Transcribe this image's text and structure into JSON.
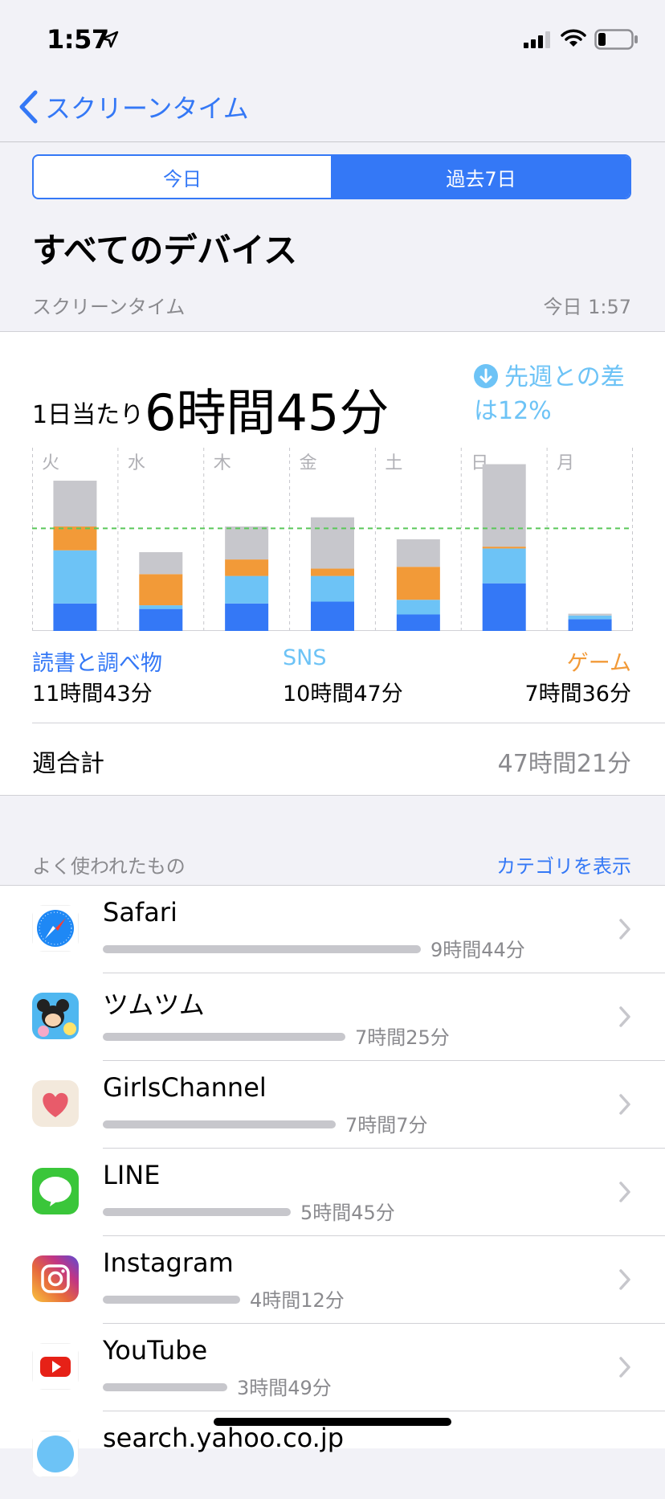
{
  "status": {
    "time": "1:57"
  },
  "nav": {
    "back_label": "スクリーンタイム"
  },
  "segment": {
    "today": "今日",
    "week": "過去7日"
  },
  "device_title": "すべてのデバイス",
  "section": {
    "label": "スクリーンタイム",
    "updated": "今日 1:57"
  },
  "summary": {
    "avg_label": "1日当たり",
    "avg_value": "6時間45分",
    "diff_text": "先週との差は12%"
  },
  "chart_data": {
    "type": "bar",
    "stacked": true,
    "categories": [
      "火",
      "水",
      "木",
      "金",
      "土",
      "日",
      "月"
    ],
    "series": [
      {
        "name": "読書と調べ物",
        "color": "#3478f6",
        "values": [
          0.75,
          0.6,
          0.75,
          0.8,
          0.45,
          1.3,
          0.32
        ]
      },
      {
        "name": "SNS",
        "color": "#6dc3f6",
        "values": [
          1.45,
          0.1,
          0.75,
          0.7,
          0.4,
          0.95,
          0.1
        ]
      },
      {
        "name": "ゲーム",
        "color": "#f29a38",
        "values": [
          0.65,
          0.85,
          0.45,
          0.2,
          0.9,
          0.05,
          0.0
        ]
      },
      {
        "name": "その他",
        "color": "#c7c7cc",
        "values": [
          1.25,
          0.6,
          0.9,
          1.4,
          0.75,
          2.25,
          0.05
        ]
      }
    ],
    "average": 2.8,
    "ylim": [
      0,
      5
    ],
    "grid": true
  },
  "categories": [
    {
      "name": "読書と調べ物",
      "value": "11時間43分"
    },
    {
      "name": "SNS",
      "value": "10時間47分"
    },
    {
      "name": "ゲーム",
      "value": "7時間36分"
    }
  ],
  "weekly": {
    "label": "週合計",
    "value": "47時間21分"
  },
  "most_used": {
    "label": "よく使われたもの",
    "link": "カテゴリを表示"
  },
  "apps": [
    {
      "name": "Safari",
      "time": "9時間44分",
      "fraction": 1.0,
      "icon": "safari-icon"
    },
    {
      "name": "ツムツム",
      "time": "7時間25分",
      "fraction": 0.763,
      "icon": "tsumtsum-icon"
    },
    {
      "name": "GirlsChannel",
      "time": "7時間7分",
      "fraction": 0.732,
      "icon": "girlschannel-icon"
    },
    {
      "name": "LINE",
      "time": "5時間45分",
      "fraction": 0.591,
      "icon": "line-icon"
    },
    {
      "name": "Instagram",
      "time": "4時間12分",
      "fraction": 0.432,
      "icon": "instagram-icon"
    },
    {
      "name": "YouTube",
      "time": "3時間49分",
      "fraction": 0.392,
      "icon": "youtube-icon"
    },
    {
      "name": "search.yahoo.co.jp",
      "time": "",
      "fraction": 0.3,
      "icon": "yahoo-icon"
    }
  ]
}
